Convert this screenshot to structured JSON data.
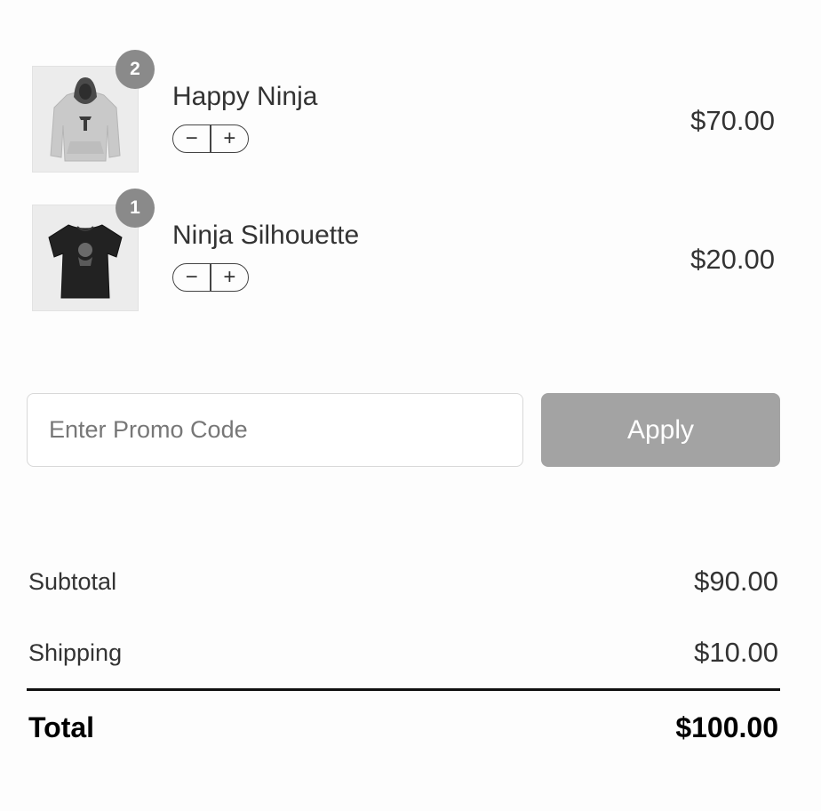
{
  "cart": {
    "items": [
      {
        "name": "Happy Ninja",
        "quantity": "2",
        "price": "$70.00",
        "image_icon": "hoodie-icon",
        "decrease_symbol": "−",
        "increase_symbol": "+"
      },
      {
        "name": "Ninja Silhouette",
        "quantity": "1",
        "price": "$20.00",
        "image_icon": "tshirt-icon",
        "decrease_symbol": "−",
        "increase_symbol": "+"
      }
    ]
  },
  "promo": {
    "placeholder": "Enter Promo Code",
    "value": "",
    "apply_label": "Apply"
  },
  "summary": {
    "subtotal_label": "Subtotal",
    "subtotal_value": "$90.00",
    "shipping_label": "Shipping",
    "shipping_value": "$10.00",
    "total_label": "Total",
    "total_value": "$100.00"
  },
  "colors": {
    "badge": "#8a8a8a",
    "apply_button": "#a3a3a3",
    "text": "#333333",
    "divider": "#111111"
  }
}
